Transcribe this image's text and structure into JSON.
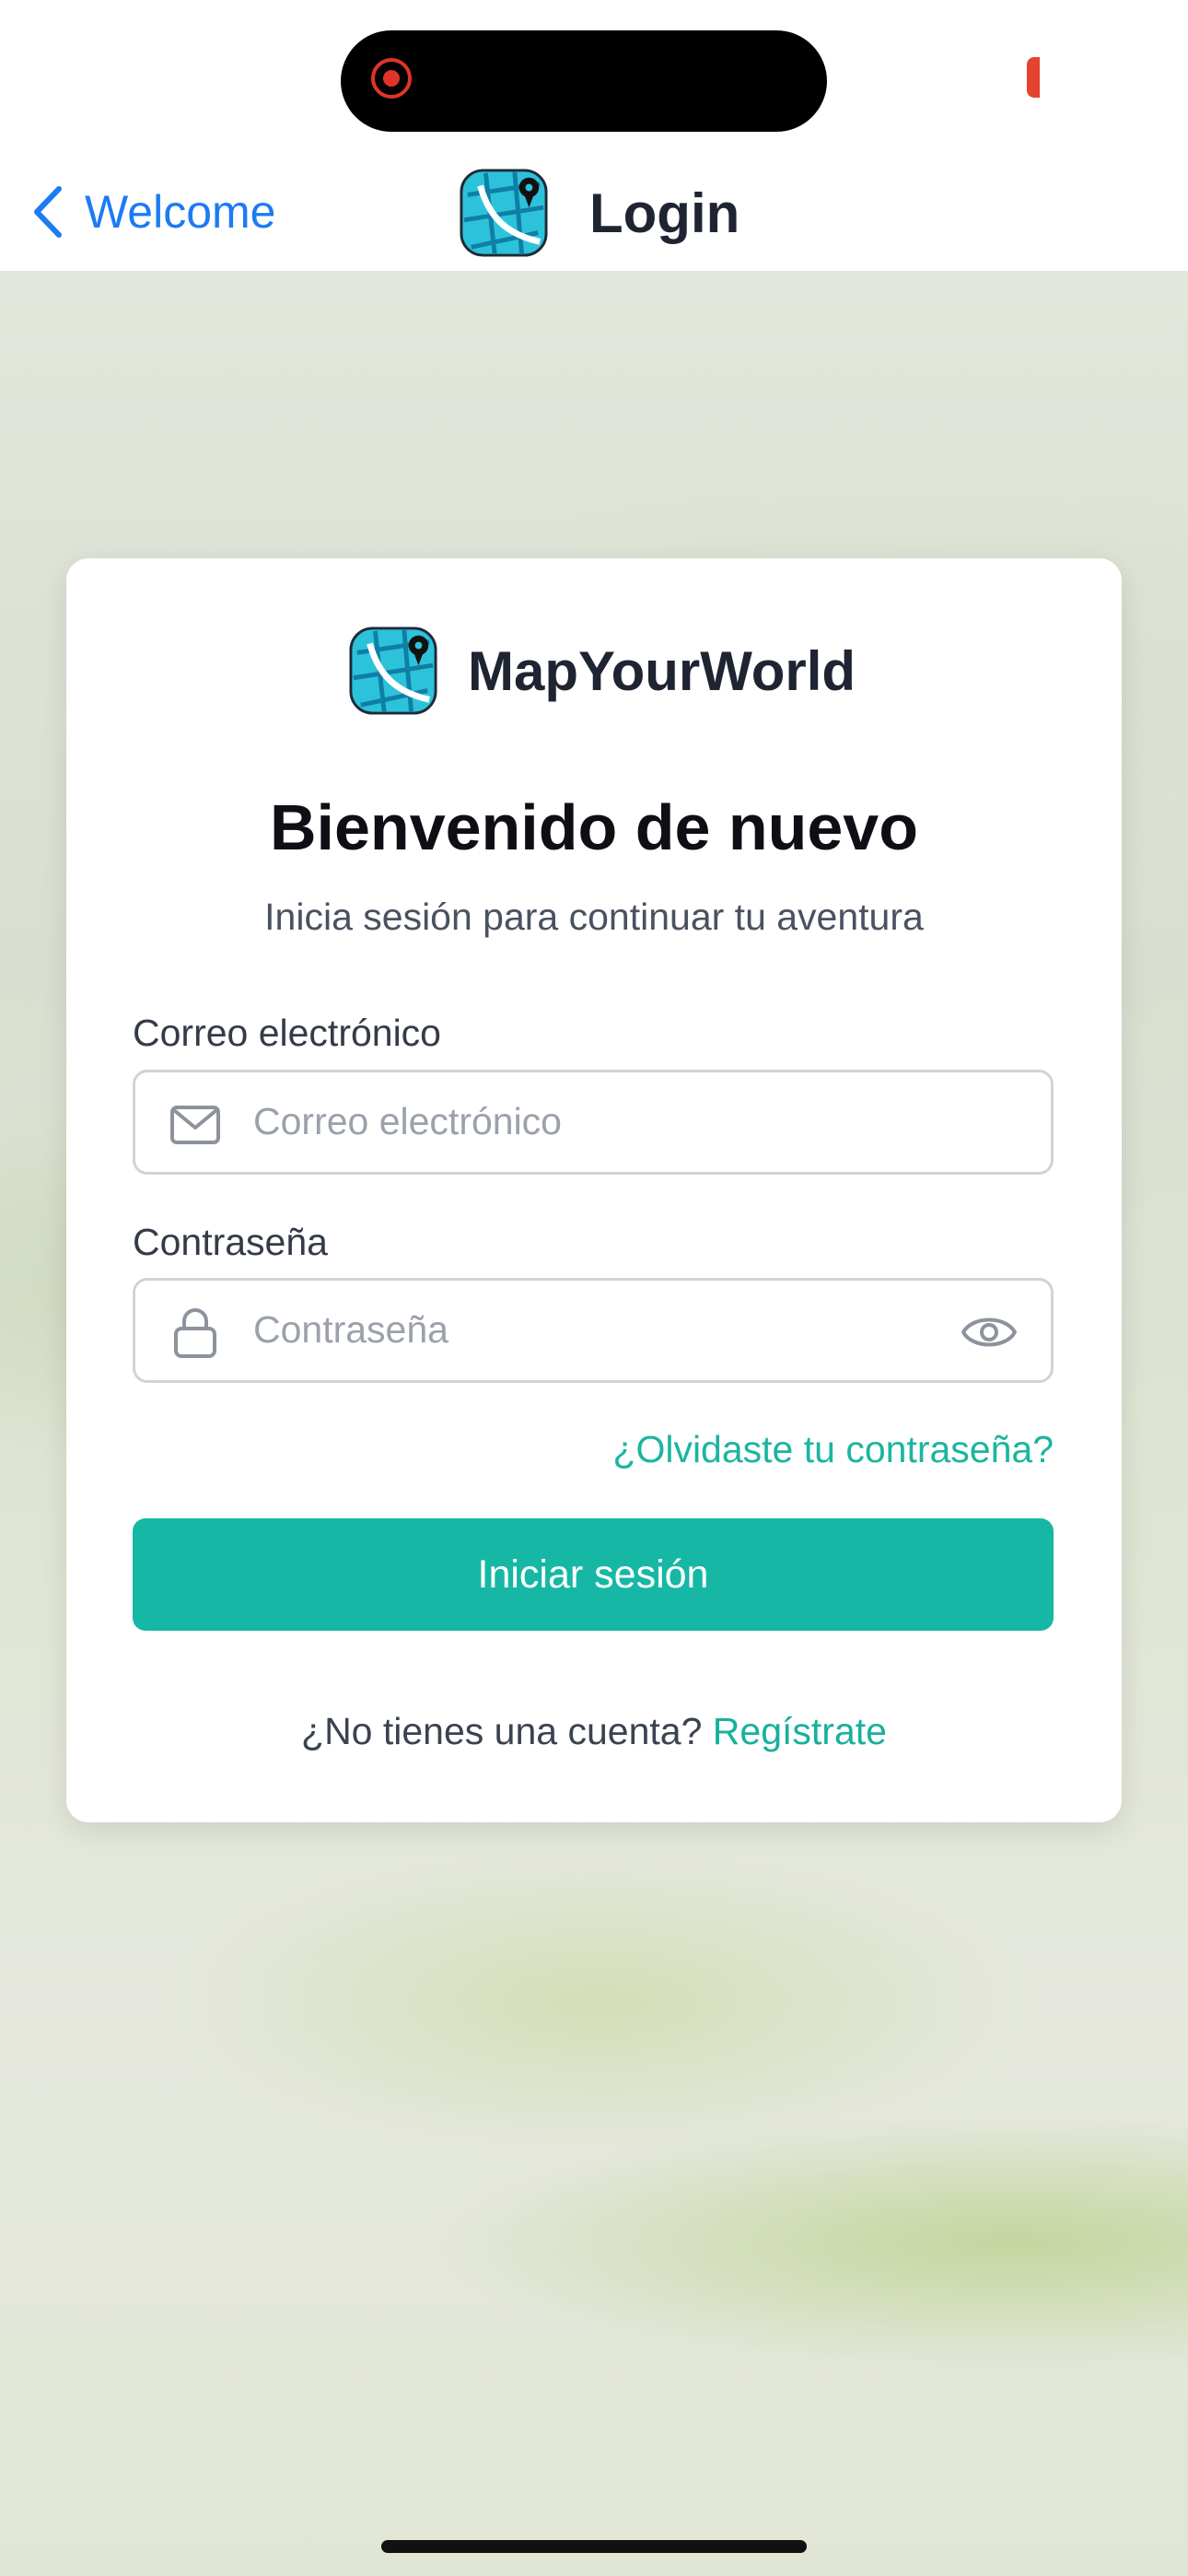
{
  "nav": {
    "back_label": "Welcome",
    "title": "Login"
  },
  "brand": {
    "name": "MapYourWorld"
  },
  "card": {
    "title": "Bienvenido de nuevo",
    "subtitle": "Inicia sesión para continuar tu aventura"
  },
  "form": {
    "email_label": "Correo electrónico",
    "email_placeholder": "Correo electrónico",
    "password_label": "Contraseña",
    "password_placeholder": "Contraseña",
    "forgot_link": "¿Olvidaste tu contraseña?",
    "submit_label": "Iniciar sesión"
  },
  "signup": {
    "prompt": "¿No tienes una cuenta?",
    "link": "Regístrate"
  },
  "colors": {
    "accent": "#16b8a5",
    "ios_blue": "#1d7bf3",
    "recording_red": "#e0342b"
  },
  "icons": [
    "recording-icon",
    "chevron-left-icon",
    "app-logo-icon",
    "mail-icon",
    "lock-icon",
    "eye-icon"
  ]
}
